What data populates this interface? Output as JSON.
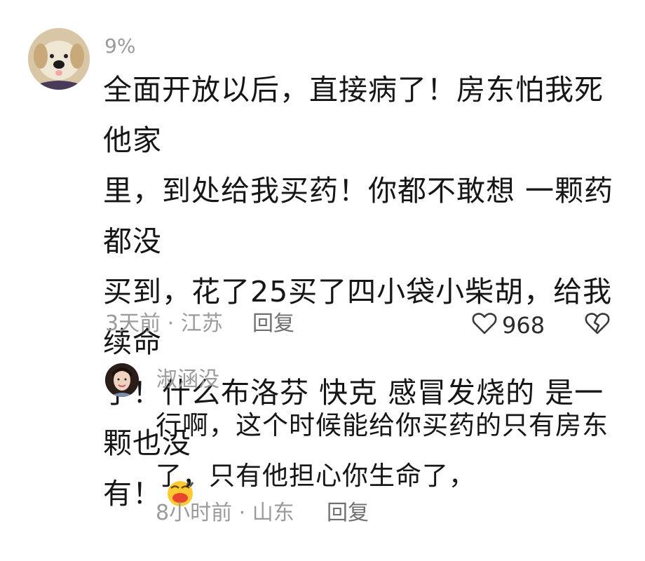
{
  "comment": {
    "username": "9%",
    "avatar_icon": "puppy-avatar-icon",
    "text": "全面开放以后，直接病了！房东怕我死他家\n里，到处给我买药！你都不敢想 一颗药都没\n买到，花了25买了四小袋小柴胡，给我续命\n了！什么布洛芬 快克 感冒发烧的 是一颗也没\n有！",
    "emoji_icon": "crying-face-emoji-icon",
    "time_location": "3天前 · 江苏",
    "reply_label": "回复",
    "like_count": "968",
    "like_icon": "heart-outline-icon",
    "dislike_icon": "broken-heart-icon"
  },
  "reply": {
    "username": "淑涵没",
    "avatar_icon": "woman-avatar-icon",
    "text": "行啊，这个时候能给你买药的只有房东\n了，只有他担心你生命了，",
    "time_location": "8小时前 · 山东",
    "reply_label": "回复"
  },
  "colors": {
    "text_primary": "#161616",
    "text_secondary": "#9b9b9b",
    "background": "#ffffff"
  }
}
